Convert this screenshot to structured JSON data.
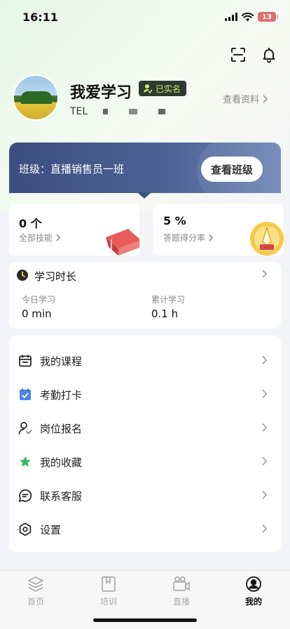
{
  "status": {
    "time": "16:11",
    "battery": "13"
  },
  "profile": {
    "name": "我爱学习",
    "verified_label": "已实名",
    "tel_prefix": "TEL",
    "view_profile": "查看资料"
  },
  "class_banner": {
    "label": "班级：直播销售员一班",
    "button": "查看班级"
  },
  "stats": [
    {
      "value": "0 个",
      "label": "全部技能"
    },
    {
      "value": "5 %",
      "label": "答题得分率"
    }
  ],
  "study": {
    "title": "学习时长",
    "today_label": "今日学习",
    "today_value": "0 min",
    "total_label": "累计学习",
    "total_value": "0.1 h"
  },
  "menu": [
    {
      "label": "我的课程",
      "icon": "calendar-icon"
    },
    {
      "label": "考勤打卡",
      "icon": "checkin-icon"
    },
    {
      "label": "岗位报名",
      "icon": "user-check-icon"
    },
    {
      "label": "我的收藏",
      "icon": "star-icon"
    },
    {
      "label": "联系客服",
      "icon": "chat-icon"
    },
    {
      "label": "设置",
      "icon": "settings-icon"
    }
  ],
  "tabs": [
    {
      "label": "首页",
      "icon": "layers-icon",
      "active": false
    },
    {
      "label": "培训",
      "icon": "book-icon",
      "active": false
    },
    {
      "label": "直播",
      "icon": "camera-icon",
      "active": false
    },
    {
      "label": "我的",
      "icon": "profile-icon",
      "active": true
    }
  ],
  "colors": {
    "banner": "#3c4e7e",
    "badge_bg": "#2d3a2f",
    "badge_text": "#d8e86c",
    "checkin_blue": "#4a86e8",
    "star_green": "#39b86a"
  }
}
